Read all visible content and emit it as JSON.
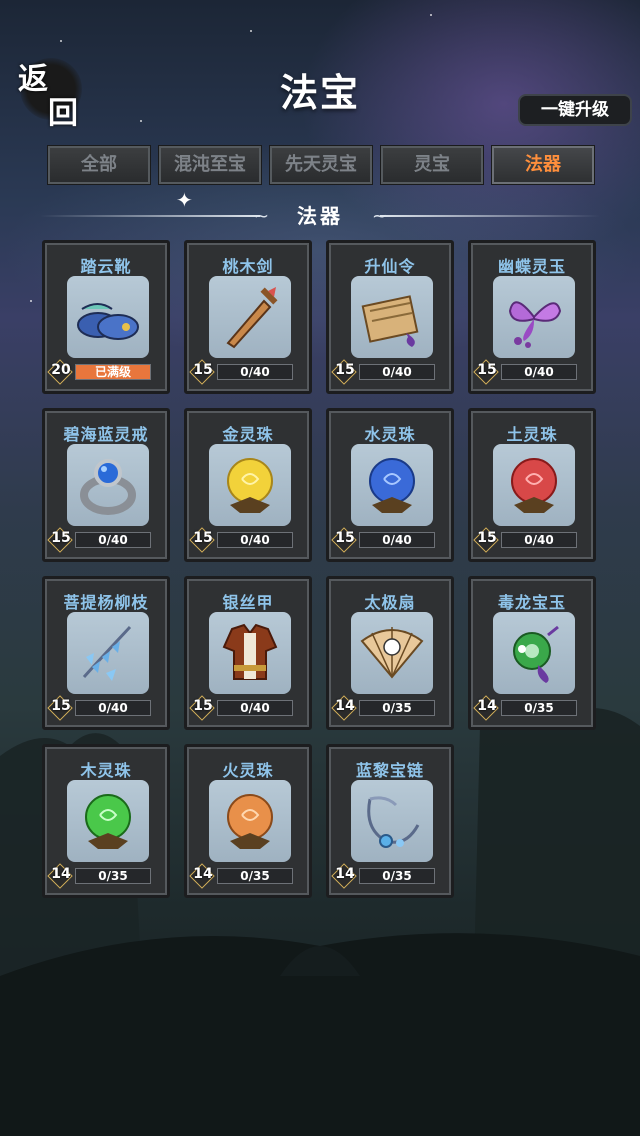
{
  "header": {
    "back_char_1": "返",
    "back_char_2": "回",
    "title": "法宝",
    "upgrade_all": "一键升级"
  },
  "tabs": [
    {
      "label": "全部",
      "active": false
    },
    {
      "label": "混沌至宝",
      "active": false
    },
    {
      "label": "先天灵宝",
      "active": false
    },
    {
      "label": "灵宝",
      "active": false
    },
    {
      "label": "法器",
      "active": true
    }
  ],
  "section": {
    "label": "法器"
  },
  "items": [
    {
      "name": "踏云靴",
      "level": "20",
      "progress": "已满级",
      "fill": 1.0,
      "icon": "boots-icon"
    },
    {
      "name": "桃木剑",
      "level": "15",
      "progress": "0/40",
      "fill": 0,
      "icon": "wooden-sword-icon"
    },
    {
      "name": "升仙令",
      "level": "15",
      "progress": "0/40",
      "fill": 0,
      "icon": "scroll-icon"
    },
    {
      "name": "幽蝶灵玉",
      "level": "15",
      "progress": "0/40",
      "fill": 0,
      "icon": "butterfly-jade-icon"
    },
    {
      "name": "碧海蓝灵戒",
      "level": "15",
      "progress": "0/40",
      "fill": 0,
      "icon": "ring-icon"
    },
    {
      "name": "金灵珠",
      "level": "15",
      "progress": "0/40",
      "fill": 0,
      "icon": "gold-orb-icon"
    },
    {
      "name": "水灵珠",
      "level": "15",
      "progress": "0/40",
      "fill": 0,
      "icon": "water-orb-icon"
    },
    {
      "name": "土灵珠",
      "level": "15",
      "progress": "0/40",
      "fill": 0,
      "icon": "earth-orb-icon"
    },
    {
      "name": "菩提杨柳枝",
      "level": "15",
      "progress": "0/40",
      "fill": 0,
      "icon": "willow-branch-icon"
    },
    {
      "name": "银丝甲",
      "level": "15",
      "progress": "0/40",
      "fill": 0,
      "icon": "armor-icon"
    },
    {
      "name": "太极扇",
      "level": "14",
      "progress": "0/35",
      "fill": 0,
      "icon": "fan-icon"
    },
    {
      "name": "毒龙宝玉",
      "level": "14",
      "progress": "0/35",
      "fill": 0,
      "icon": "poison-jade-icon"
    },
    {
      "name": "木灵珠",
      "level": "14",
      "progress": "0/35",
      "fill": 0,
      "icon": "wood-orb-icon"
    },
    {
      "name": "火灵珠",
      "level": "14",
      "progress": "0/35",
      "fill": 0,
      "icon": "fire-orb-icon"
    },
    {
      "name": "蓝黎宝链",
      "level": "14",
      "progress": "0/35",
      "fill": 0,
      "icon": "necklace-icon"
    }
  ],
  "colors": {
    "item_name": "#8fc4ea",
    "tab_active": "#ff8f3c",
    "max_fill": "#e8763c"
  }
}
